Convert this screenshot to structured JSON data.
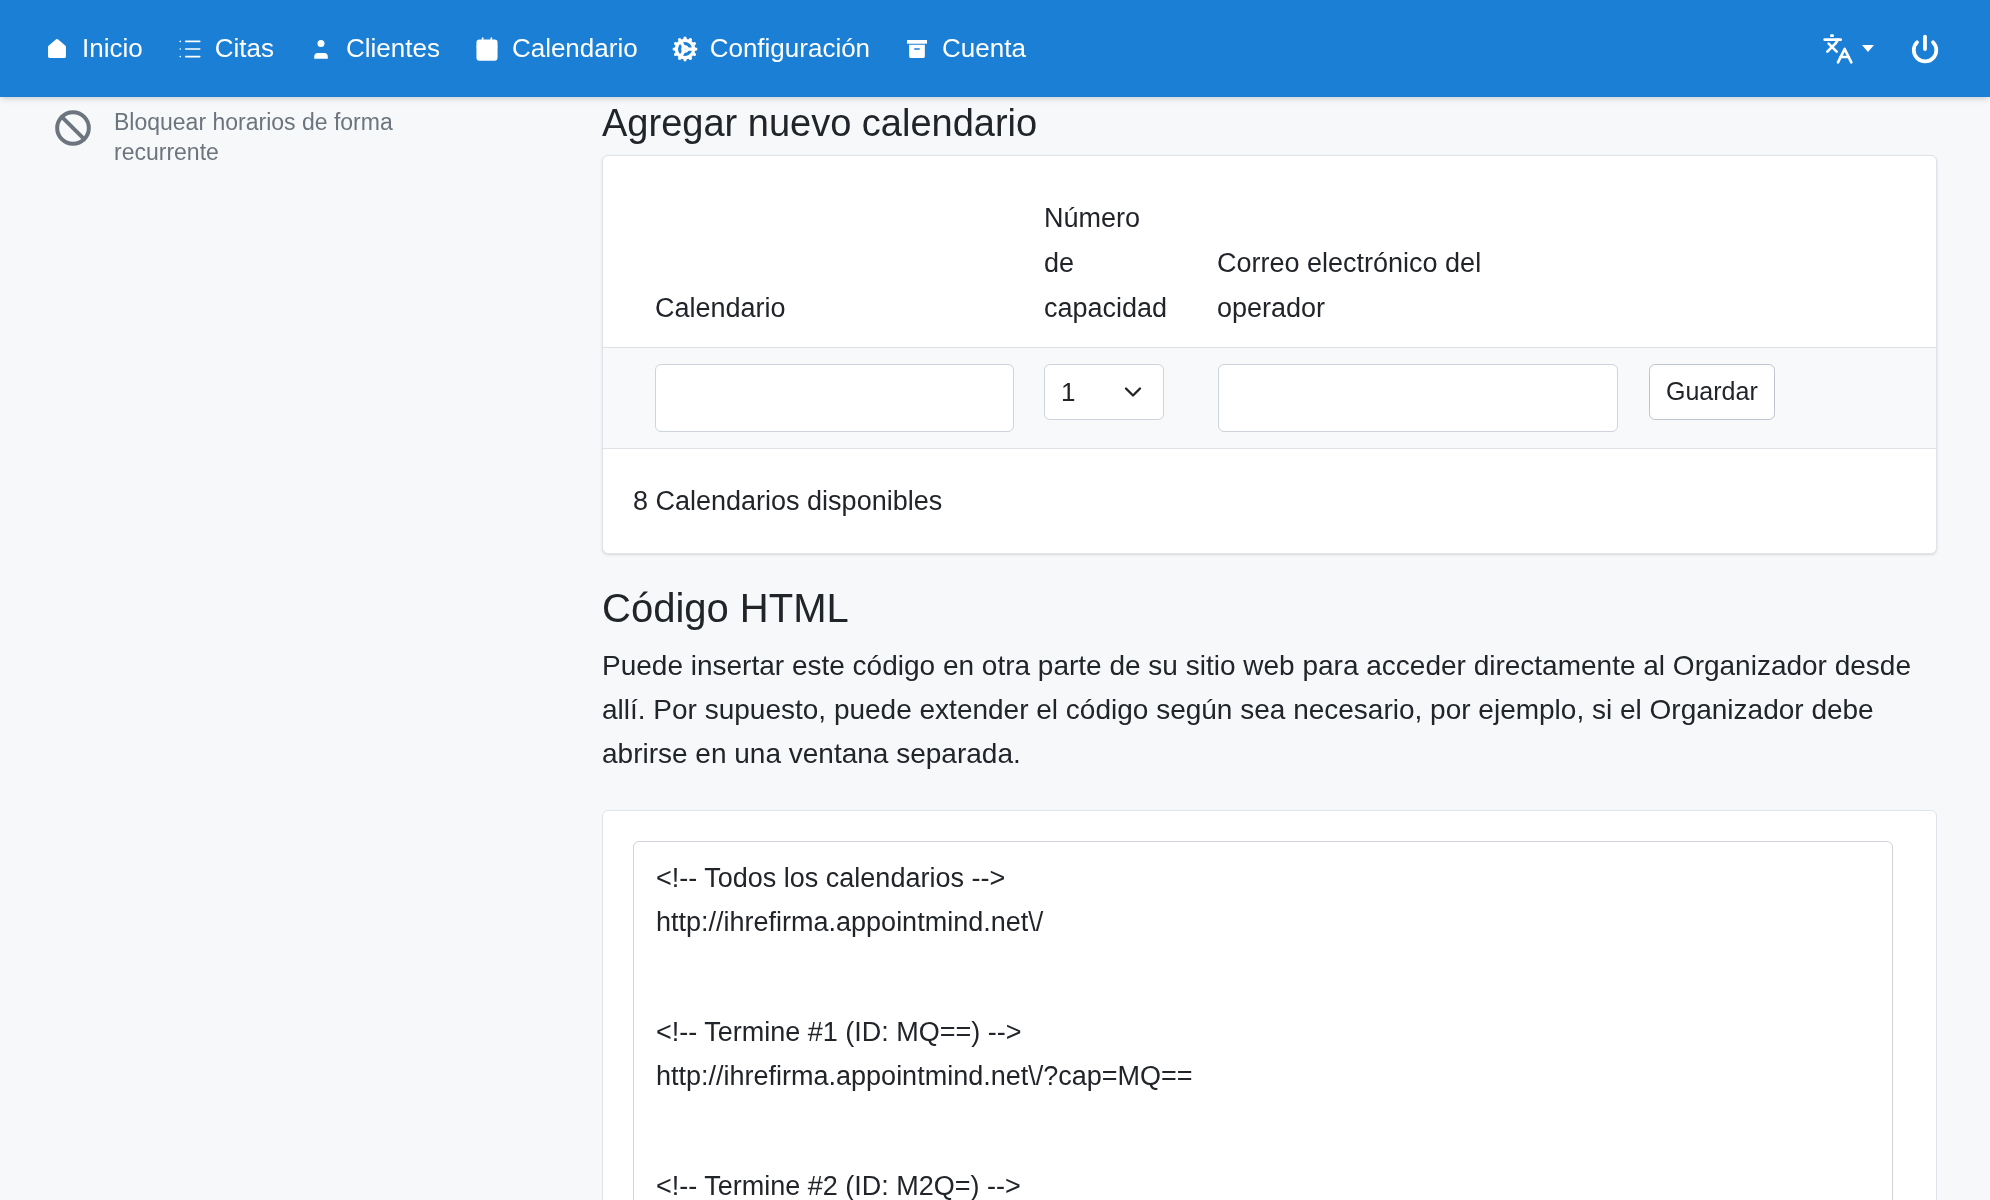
{
  "navbar": {
    "items": [
      {
        "kind": "home",
        "label": "Inicio"
      },
      {
        "kind": "list",
        "label": "Citas"
      },
      {
        "kind": "user",
        "label": "Clientes"
      },
      {
        "kind": "calendar",
        "label": "Calendario"
      },
      {
        "kind": "gears",
        "label": "Configuración"
      },
      {
        "kind": "archive",
        "label": "Cuenta"
      }
    ]
  },
  "sidebar": {
    "items": [
      {
        "kind": "block",
        "label": "Bloquear horarios de forma recurrente"
      }
    ]
  },
  "add_calendar": {
    "title": "Agregar nuevo calendario",
    "columns": [
      "Calendario",
      "Número de capacidad",
      "Correo electrónico del operador"
    ],
    "capacity": {
      "value": "1"
    },
    "save_button": "Guardar",
    "footer": "8 Calendarios disponibles"
  },
  "html_code": {
    "title": "Código HTML",
    "description": "Puede insertar este código en otra parte de su sitio web para acceder directamente al Organizador desde allí. Por supuesto, puede extender el código según sea necesario, por ejemplo, si el Organizador debe abrirse en una ventana separada.",
    "blocks": [
      {
        "lines": [
          "<!-- Todos los calendarios -->",
          "http://ihrefirma.appointmind.net\\/"
        ]
      },
      {
        "lines": [
          "<!-- Termine #1 (ID: MQ==) -->",
          "http://ihrefirma.appointmind.net\\/?cap=MQ=="
        ]
      },
      {
        "lines": [
          "<!-- Termine #2 (ID: M2Q=) -->"
        ]
      }
    ]
  }
}
